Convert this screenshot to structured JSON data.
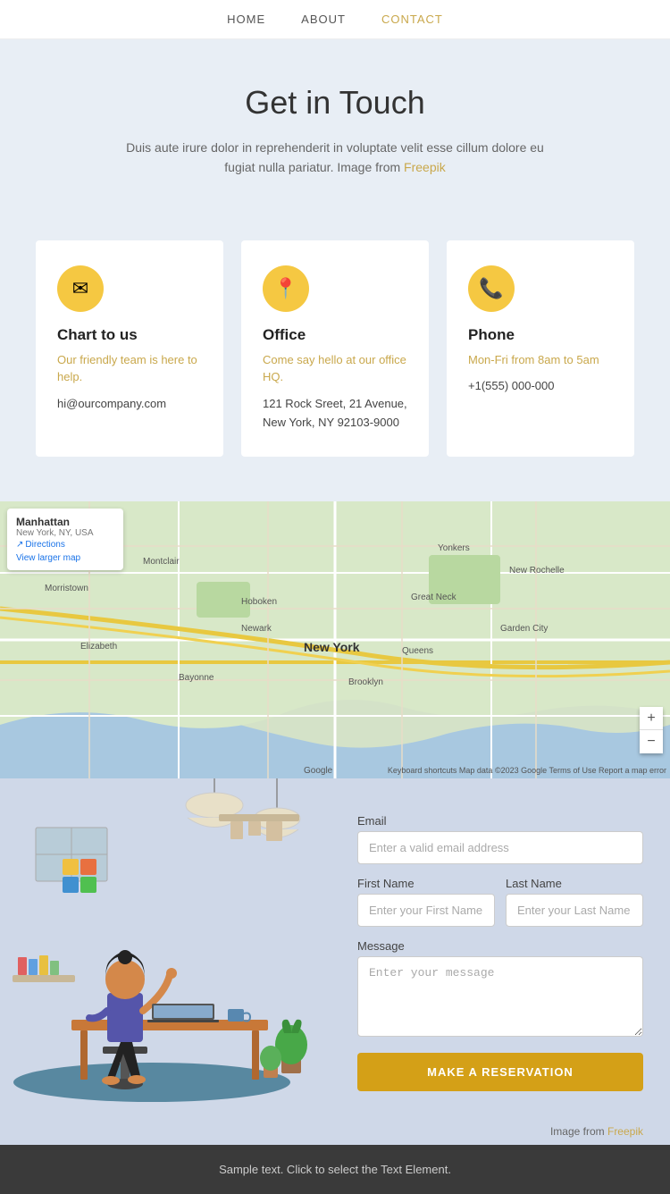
{
  "nav": {
    "items": [
      {
        "label": "HOME",
        "active": false
      },
      {
        "label": "ABOUT",
        "active": false
      },
      {
        "label": "CONTACT",
        "active": true
      }
    ]
  },
  "hero": {
    "title": "Get in Touch",
    "description": "Duis aute irure dolor in reprehenderit in voluptate velit esse cillum dolore eu fugiat nulla pariatur. Image from",
    "freepik_link": "Freepik"
  },
  "cards": [
    {
      "icon": "✉",
      "title": "Chart to us",
      "subtitle": "Our friendly team is here to help.",
      "detail": "hi@ourcompany.com"
    },
    {
      "icon": "📍",
      "title": "Office",
      "subtitle": "Come say hello at our office HQ.",
      "detail": "121 Rock Sreet, 21 Avenue,\nNew York, NY 92103-9000"
    },
    {
      "icon": "📞",
      "title": "Phone",
      "subtitle": "Mon-Fri from 8am to 5am",
      "detail": "+1(555) 000-000"
    }
  ],
  "map": {
    "location_title": "Manhattan",
    "location_sub": "New York, NY, USA",
    "directions_label": "Directions",
    "larger_map": "View larger map",
    "zoom_in": "+",
    "zoom_out": "−",
    "attribution": "Keyboard shortcuts   Map data ©2023 Google   Terms of Use   Report a map error"
  },
  "form": {
    "email_label": "Email",
    "email_placeholder": "Enter a valid email address",
    "first_name_label": "First Name",
    "first_name_placeholder": "Enter your First Name",
    "last_name_label": "Last Name",
    "last_name_placeholder": "Enter your Last Name",
    "message_label": "Message",
    "message_placeholder": "Enter your message",
    "submit_label": "MAKE A RESERVATION",
    "image_credit_prefix": "Image from",
    "image_credit_link": "Freepik"
  },
  "footer": {
    "text": "Sample text. Click to select the Text Element."
  }
}
